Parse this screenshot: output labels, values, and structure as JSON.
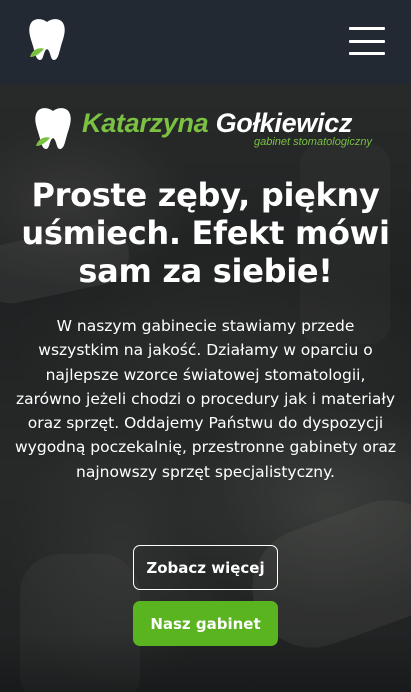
{
  "header": {
    "logo_icon": "tooth-leaf-icon",
    "menu_icon": "hamburger-icon"
  },
  "hero": {
    "brand": {
      "first_name": "Katarzyna",
      "last_name": "Gołkiewicz",
      "subtitle": "gabinet stomatologiczny"
    },
    "headline": "Proste zęby, piękny uśmiech. Efekt mówi sam za siebie!",
    "description": "W naszym gabinecie stawiamy przede wszystkim na jakość. Działamy w oparciu o najlepsze wzorce światowej stomatologii, zarówno jeżeli chodzi o procedury jak i materiały oraz sprzęt. Oddajemy Państwu do dyspozycji wygodną poczekalnię, przestronne gabinety oraz najnowszy sprzęt specjalistyczny.",
    "buttons": {
      "more_label": "Zobacz więcej",
      "office_label": "Nasz gabinet"
    }
  },
  "colors": {
    "header_bg": "#222933",
    "accent_green": "#5ab41f",
    "brand_green": "#7bc142"
  }
}
